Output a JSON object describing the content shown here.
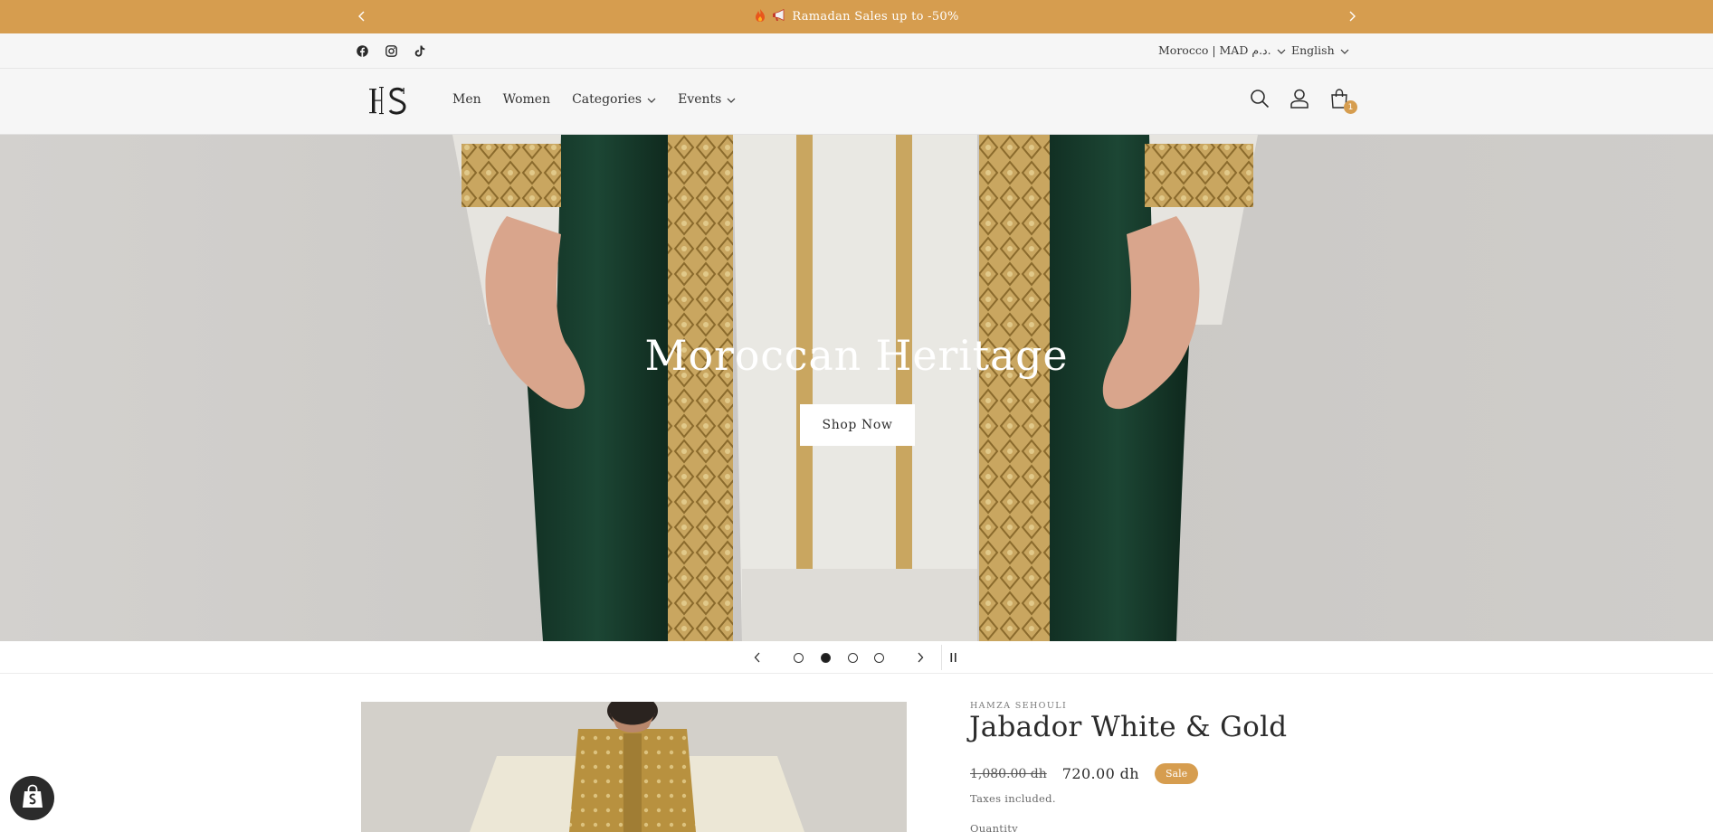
{
  "announcement": {
    "icon_left": "fire-icon",
    "icon_right": "megaphone-icon",
    "text": "Ramadan Sales up to -50%",
    "background": "#d69d4f"
  },
  "utility": {
    "social": [
      "facebook-icon",
      "instagram-icon",
      "tiktok-icon"
    ],
    "locale": "Morocco | MAD د.م.",
    "language": "English"
  },
  "header": {
    "logo": "HS",
    "nav": [
      {
        "label": "Men",
        "dropdown": false
      },
      {
        "label": "Women",
        "dropdown": false
      },
      {
        "label": "Categories",
        "dropdown": true
      },
      {
        "label": "Events",
        "dropdown": true
      }
    ],
    "icons": [
      "search-icon",
      "account-icon",
      "cart-icon"
    ],
    "cart_count": "1"
  },
  "hero": {
    "title": "Moroccan Heritage",
    "button": "Shop Now"
  },
  "slider": {
    "slides": 4,
    "active_slide": 2
  },
  "product": {
    "vendor": "HAMZA SEHOULI",
    "title": "Jabador White & Gold",
    "old_price": "1,080.00 dh",
    "price": "720.00 dh",
    "badge": "Sale",
    "taxes": "Taxes included.",
    "quantity_label": "Quantity"
  },
  "colors": {
    "accent": "#d69d4f",
    "header_bg": "#f6f6f6"
  }
}
